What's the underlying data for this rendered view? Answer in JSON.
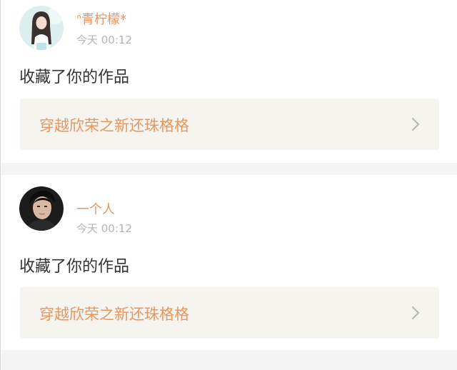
{
  "notifications": [
    {
      "username": "ᐢ青柠檬*",
      "timestamp": "今天 00:12",
      "action": "收藏了你的作品",
      "work_title": "穿越欣荣之新还珠格格",
      "avatar_icon": "avatar-woman-icon",
      "chevron_icon": "chevron-right-icon"
    },
    {
      "username": "一个人",
      "timestamp": "今天 00:12",
      "action": "收藏了你的作品",
      "work_title": "穿越欣荣之新还珠格格",
      "avatar_icon": "avatar-man-icon",
      "chevron_icon": "chevron-right-icon"
    }
  ],
  "colors": {
    "accent": "#e8965f",
    "timestamp": "#b5b5b5",
    "action_text": "#333333",
    "link_background": "#f5f4ef",
    "divider": "#f4f4f4"
  }
}
